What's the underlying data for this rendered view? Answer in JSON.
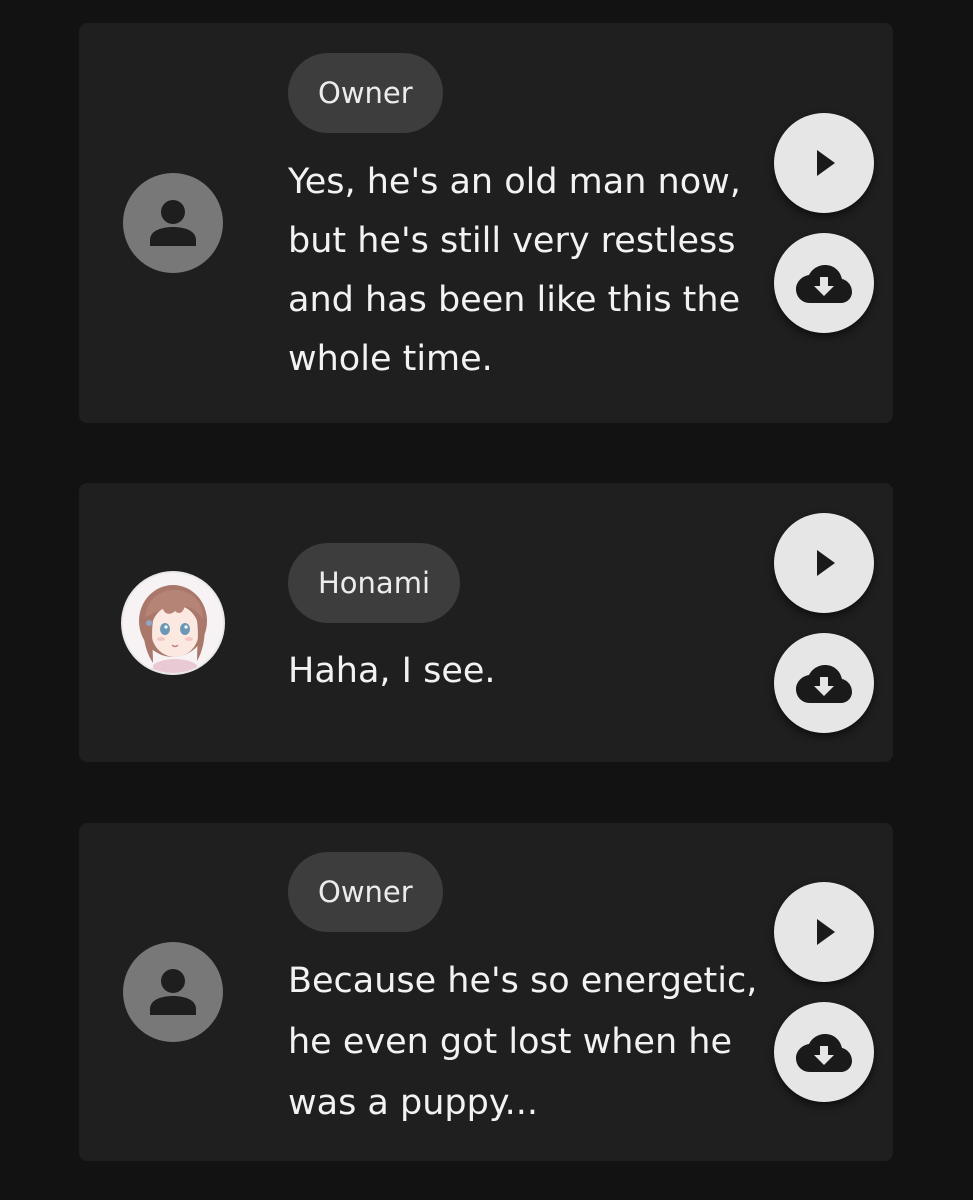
{
  "messages": [
    {
      "speaker": "Owner",
      "avatar": "default-person-icon",
      "text": "Yes, he's an old man now, but he's still very restless and has been like this the whole time."
    },
    {
      "speaker": "Honami",
      "avatar": "character-portrait",
      "text": "Haha, I see."
    },
    {
      "speaker": "Owner",
      "avatar": "default-person-icon",
      "text": "Because he's so energetic, he even got lost when he was a puppy..."
    }
  ],
  "icons": {
    "play": "play-icon",
    "download": "cloud-download-icon",
    "person": "person-icon"
  },
  "colors": {
    "background": "#121212",
    "card": "#1f1f1f",
    "chip": "#3d3d3d",
    "button": "#e6e6e6",
    "default_avatar": "#787878"
  }
}
